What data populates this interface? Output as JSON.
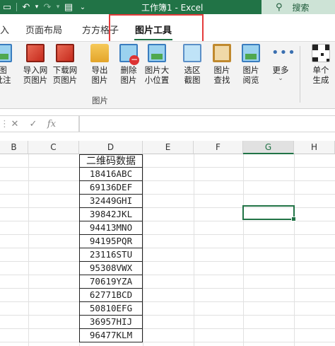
{
  "titlebar": {
    "title": "工作簿1  -  Excel",
    "search_label": "搜索",
    "icons": [
      "save-icon",
      "undo-icon",
      "redo-icon",
      "file-icon",
      "dropdown-icon"
    ]
  },
  "tabs": [
    {
      "label": "入"
    },
    {
      "label": "页面布局"
    },
    {
      "label": "方方格子"
    },
    {
      "label": "图片工具",
      "active": true
    }
  ],
  "ribbon": {
    "buttons": [
      {
        "label": "图\n批注"
      },
      {
        "label": "导入网\n页图片"
      },
      {
        "label": "下载网\n页图片"
      },
      {
        "label": "导出\n图片"
      },
      {
        "label": "删除\n图片"
      },
      {
        "label": "图片大\n小位置"
      },
      {
        "label": "选区\n截图"
      },
      {
        "label": "图片\n查找"
      },
      {
        "label": "图片\n阅览"
      },
      {
        "label": "更多"
      },
      {
        "label": "单个\n生成"
      }
    ],
    "group_label": "图片"
  },
  "formula_bar": {
    "cancel": "✕",
    "enter": "✓",
    "fx": "fx",
    "value": ""
  },
  "columns": [
    "B",
    "C",
    "D",
    "E",
    "F",
    "G",
    "H"
  ],
  "selected_column": "G",
  "column_d": {
    "header": "二维码数据",
    "values": [
      "18416ABC",
      "69136DEF",
      "32449GHI",
      "39842JKL",
      "94413MNO",
      "94195PQR",
      "23116STU",
      "95308VWX",
      "70619YZA",
      "62771BCD",
      "50810EFG",
      "36957HIJ",
      "96477KLM"
    ]
  },
  "colors": {
    "accent": "#217346",
    "highlight": "#e43b3b"
  }
}
